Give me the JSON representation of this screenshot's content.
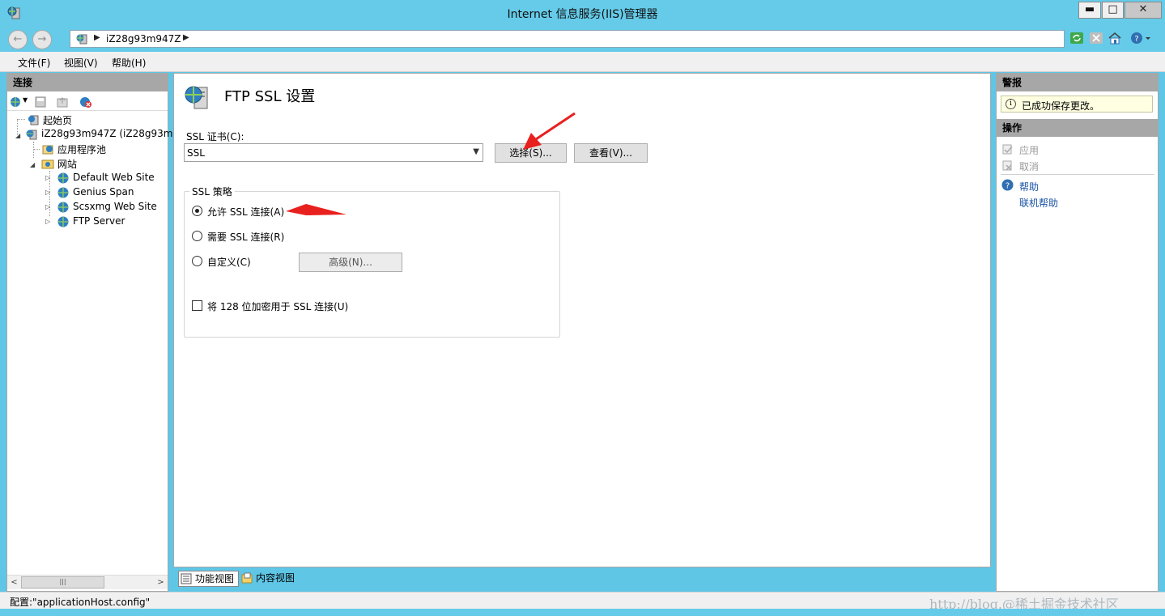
{
  "window": {
    "title": "Internet 信息服务(IIS)管理器"
  },
  "address": {
    "crumb": "iZ28g93m947Z"
  },
  "menu": {
    "file": "文件(F)",
    "view": "视图(V)",
    "help": "帮助(H)"
  },
  "connections": {
    "header": "连接",
    "tree": {
      "start_page": "起始页",
      "server": "iZ28g93m947Z (iZ28g93m9",
      "app_pools": "应用程序池",
      "sites": "网站",
      "site_items": [
        "Default Web Site",
        "Genius Span",
        "Scsxmg Web Site",
        "FTP Server"
      ]
    }
  },
  "main": {
    "title": "FTP SSL 设置",
    "cert_label": "SSL 证书(C):",
    "cert_value": "SSL",
    "select_button": "选择(S)...",
    "view_button": "查看(V)...",
    "policy_legend": "SSL 策略",
    "options": {
      "allow": "允许 SSL 连接(A)",
      "require": "需要 SSL 连接(R)",
      "custom": "自定义(C)"
    },
    "selected_option": "allow",
    "advanced_button": "高级(N)...",
    "encrypt_128": "将 128 位加密用于 SSL 连接(U)",
    "encrypt_128_checked": false
  },
  "viewtabs": {
    "features": "功能视图",
    "content": "内容视图"
  },
  "alerts": {
    "header": "警报",
    "message": "已成功保存更改。"
  },
  "actions": {
    "header": "操作",
    "apply": "应用",
    "cancel": "取消",
    "help": "帮助",
    "online_help": "联机帮助"
  },
  "status": {
    "text": "配置:\"applicationHost.config\""
  },
  "watermark": "http://blog.@稀土掘金技术社区",
  "colors": {
    "accent": "#65cbe9",
    "link": "#1a52a6",
    "annotation": "#e8211e"
  }
}
